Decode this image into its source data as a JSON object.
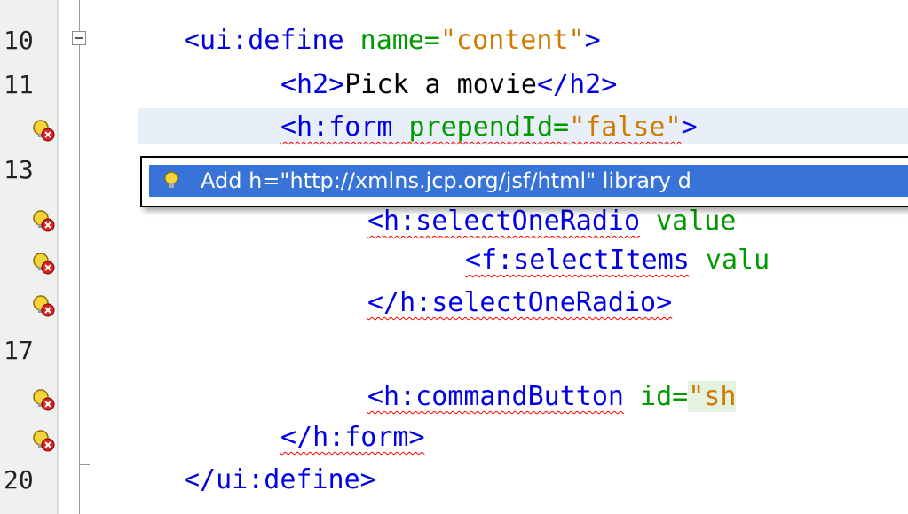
{
  "editor": {
    "lines": [
      {
        "number": "10",
        "parts": [
          "<ui:define",
          " name=",
          "\"content\"",
          ">"
        ]
      },
      {
        "number": "11",
        "parts": [
          "<h2>",
          "Pick a movie",
          "</h2>"
        ]
      },
      {
        "number": "",
        "parts": [
          "<h:form",
          " prependId=",
          "\"false\"",
          ">"
        ]
      },
      {
        "number": "13",
        "parts": []
      },
      {
        "number": "",
        "parts": [
          "<h:selectOneRadio",
          " value"
        ]
      },
      {
        "number": "",
        "parts": [
          "<f:selectItems",
          " valu"
        ]
      },
      {
        "number": "",
        "parts": [
          "</h:selectOneRadio>"
        ]
      },
      {
        "number": "17",
        "parts": []
      },
      {
        "number": "",
        "parts": [
          "<h:commandButton",
          " id=",
          "\"sh"
        ]
      },
      {
        "number": "",
        "parts": [
          "</h:form>"
        ]
      },
      {
        "number": "20",
        "parts": [
          "</ui:define>"
        ]
      }
    ]
  },
  "popup": {
    "suggestion": "Add h=\"http://xmlns.jcp.org/jsf/html\" library d"
  },
  "icons": {
    "hint": "error-hint-bulb-icon",
    "popup_bulb": "lightbulb-icon"
  },
  "colors": {
    "tag": "#0000e6",
    "attr": "#009900",
    "value": "#ce7b00",
    "error_underline": "#ff0000",
    "selection": "#3874d8"
  }
}
